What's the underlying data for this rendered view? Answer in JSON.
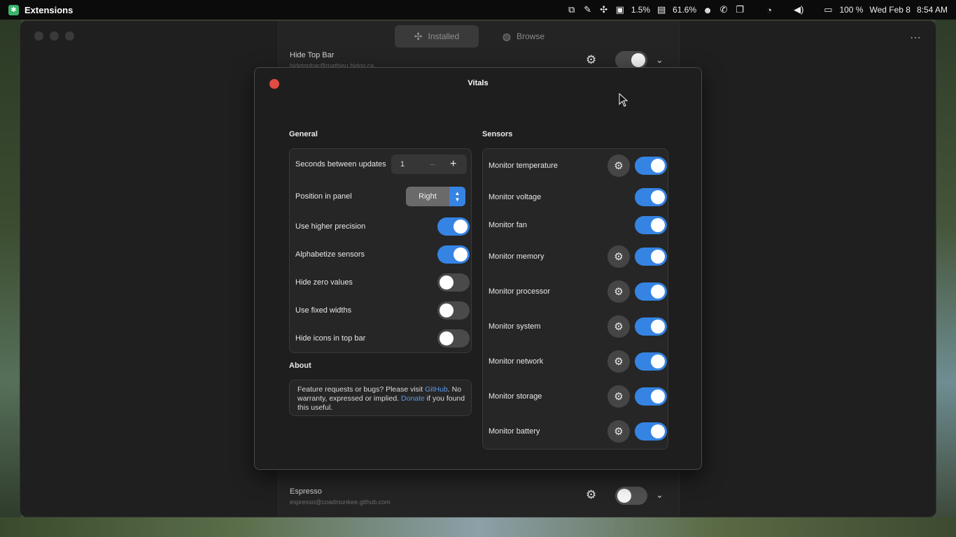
{
  "topbar": {
    "app_name": "Extensions",
    "cpu_percent": "1.5%",
    "memory_percent": "61.6%",
    "battery_percent": "100 %",
    "date": "Wed Feb 8",
    "time": "8:54 AM"
  },
  "window": {
    "tabs": [
      {
        "label": "Installed",
        "active": true
      },
      {
        "label": "Browse",
        "active": false
      }
    ],
    "extensions": [
      {
        "name": "Hide Top Bar",
        "id": "hidetopbar@mathieu.bidon.ca",
        "enabled": false
      },
      {
        "name": "Espresso",
        "id": "espresso@coadmunkee.github.com",
        "enabled": false
      }
    ]
  },
  "dialog": {
    "title": "Vitals",
    "general": {
      "title": "General",
      "seconds_label": "Seconds between updates",
      "seconds_value": "1",
      "position_label": "Position in panel",
      "position_value": "Right",
      "toggles": [
        {
          "label": "Use higher precision",
          "on": true
        },
        {
          "label": "Alphabetize sensors",
          "on": true
        },
        {
          "label": "Hide zero values",
          "on": false
        },
        {
          "label": "Use fixed widths",
          "on": false
        },
        {
          "label": "Hide icons in top bar",
          "on": false
        }
      ]
    },
    "about": {
      "title": "About",
      "text_1": "Feature requests or bugs? Please visit ",
      "link_github": "GitHub",
      "text_2": ". No warranty, expressed or implied. ",
      "link_donate": "Donate",
      "text_3": " if you found this useful."
    },
    "sensors": {
      "title": "Sensors",
      "items": [
        {
          "label": "Monitor temperature",
          "gear": true,
          "on": true
        },
        {
          "label": "Monitor voltage",
          "gear": false,
          "on": true
        },
        {
          "label": "Monitor fan",
          "gear": false,
          "on": true
        },
        {
          "label": "Monitor memory",
          "gear": true,
          "on": true
        },
        {
          "label": "Monitor processor",
          "gear": true,
          "on": true
        },
        {
          "label": "Monitor system",
          "gear": true,
          "on": true
        },
        {
          "label": "Monitor network",
          "gear": true,
          "on": true
        },
        {
          "label": "Monitor storage",
          "gear": true,
          "on": true
        },
        {
          "label": "Monitor battery",
          "gear": true,
          "on": true
        }
      ]
    }
  },
  "colors": {
    "accent": "#3584e4",
    "close": "#e04b42",
    "link": "#5a9be8"
  }
}
